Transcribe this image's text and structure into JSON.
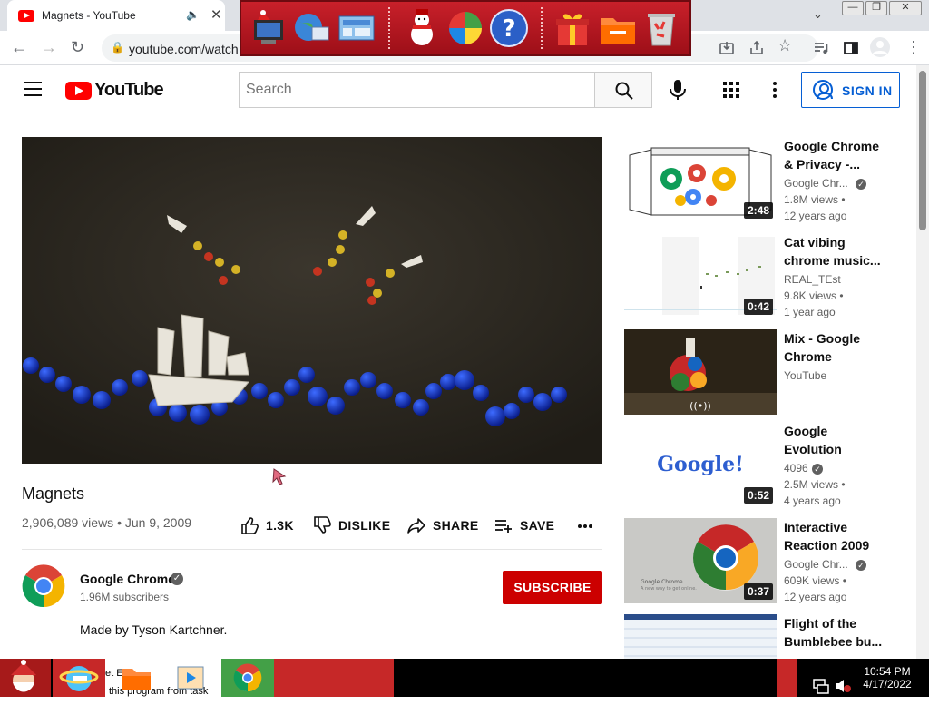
{
  "browser": {
    "tab_title": "Magnets - YouTube",
    "url": "youtube.com/watch"
  },
  "youtube": {
    "logo_text": "YouTube",
    "search_placeholder": "Search",
    "signin_label": "SIGN IN"
  },
  "video": {
    "title": "Magnets",
    "views_date": "2,906,089 views • Jun 9, 2009",
    "like_count": "1.3K",
    "dislike_label": "DISLIKE",
    "share_label": "SHARE",
    "save_label": "SAVE",
    "channel_name": "Google Chrome",
    "subscribers": "1.96M subscribers",
    "subscribe_label": "SUBSCRIBE",
    "description": "Made by Tyson Kartchner."
  },
  "recommendations": [
    {
      "title": "Google Chrome & Privacy -...",
      "channel": "Google Chr...",
      "verified": true,
      "views": "1.8M views •",
      "age": "12 years ago",
      "duration": "2:48"
    },
    {
      "title": "Cat vibing chrome music...",
      "channel": "REAL_TEst",
      "verified": false,
      "views": "9.8K views •",
      "age": "1 year ago",
      "duration": "0:42"
    },
    {
      "title": "Mix - Google Chrome",
      "channel": "YouTube",
      "verified": false,
      "views": "",
      "age": "",
      "duration": ""
    },
    {
      "title": "Google Evolution",
      "channel": "4096",
      "verified": true,
      "views": "2.5M views •",
      "age": "4 years ago",
      "duration": "0:52"
    },
    {
      "title": "Interactive Reaction 2009",
      "channel": "Google Chr...",
      "verified": true,
      "views": "609K views •",
      "age": "12 years ago",
      "duration": "0:37"
    },
    {
      "title": "Flight of the Bumblebee bu...",
      "channel": "",
      "verified": false,
      "views": "",
      "age": "",
      "duration": ""
    }
  ],
  "thumb_text": {
    "google_logo": "Google!",
    "chrome_promo": "Google Chrome.",
    "chrome_promo_sub": "A new way to get online."
  },
  "taskbar": {
    "tip_line1": "et E",
    "tip_line2": "this program from task",
    "time": "10:54 PM",
    "date": "4/17/2022"
  },
  "icons": {
    "verified": "checkmark-badge",
    "like": "thumbs-up",
    "dislike": "thumbs-down",
    "share": "share-arrow",
    "save": "playlist-add"
  },
  "colors": {
    "brand_red": "#ff0000",
    "subscribe_red": "#cc0000",
    "link_blue": "#065fd4"
  }
}
